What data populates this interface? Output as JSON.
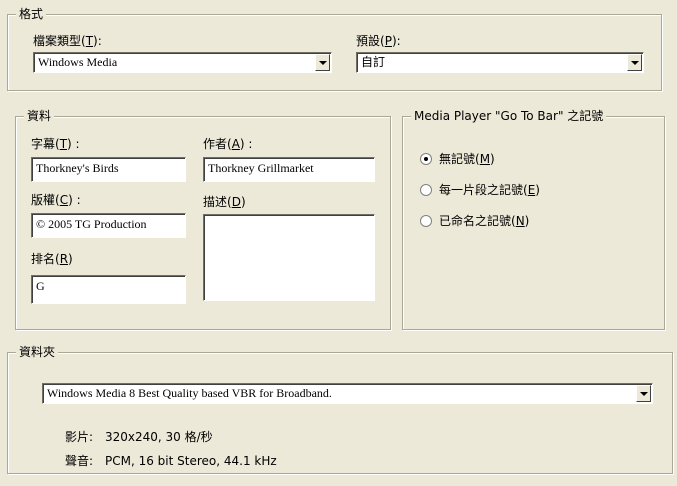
{
  "format": {
    "legend": "格式",
    "file_type_label": "檔案類型(",
    "file_type_key": "T",
    "file_type_label_end": "):",
    "file_type_value": "Windows Media",
    "preset_label": "預設(",
    "preset_key": "P",
    "preset_label_end": "):",
    "preset_value": "自訂"
  },
  "data": {
    "legend": "資料",
    "title_label": "字幕(",
    "title_key": "T",
    "title_label_end": ") :",
    "title_value": "Thorkney's Birds",
    "author_label": "作者(",
    "author_key": "A",
    "author_label_end": ") :",
    "author_value": "Thorkney Grillmarket",
    "copyright_label": "版權(",
    "copyright_key": "C",
    "copyright_label_end": ") :",
    "copyright_value": "© 2005 TG Production",
    "description_label": "描述(",
    "description_key": "D",
    "description_label_end": ")",
    "description_value": "",
    "rating_label": "排名(",
    "rating_key": "R",
    "rating_label_end": ")",
    "rating_value": "G"
  },
  "goto": {
    "legend": "Media Player \"Go To Bar\" 之記號",
    "options": [
      {
        "label": "無記號(",
        "key": "M",
        "end": ")",
        "checked": true
      },
      {
        "label": "每一片段之記號(",
        "key": "E",
        "end": ")",
        "checked": false
      },
      {
        "label": "已命名之記號(",
        "key": "N",
        "end": ")",
        "checked": false
      }
    ]
  },
  "profile": {
    "legend": "資料夾",
    "value": "Windows Media 8 Best Quality based VBR for Broadband.",
    "video_label": "影片:",
    "video_value": "320x240, 30 格/秒",
    "audio_label": "聲音:",
    "audio_value": "PCM, 16 bit Stereo, 44.1 kHz"
  }
}
